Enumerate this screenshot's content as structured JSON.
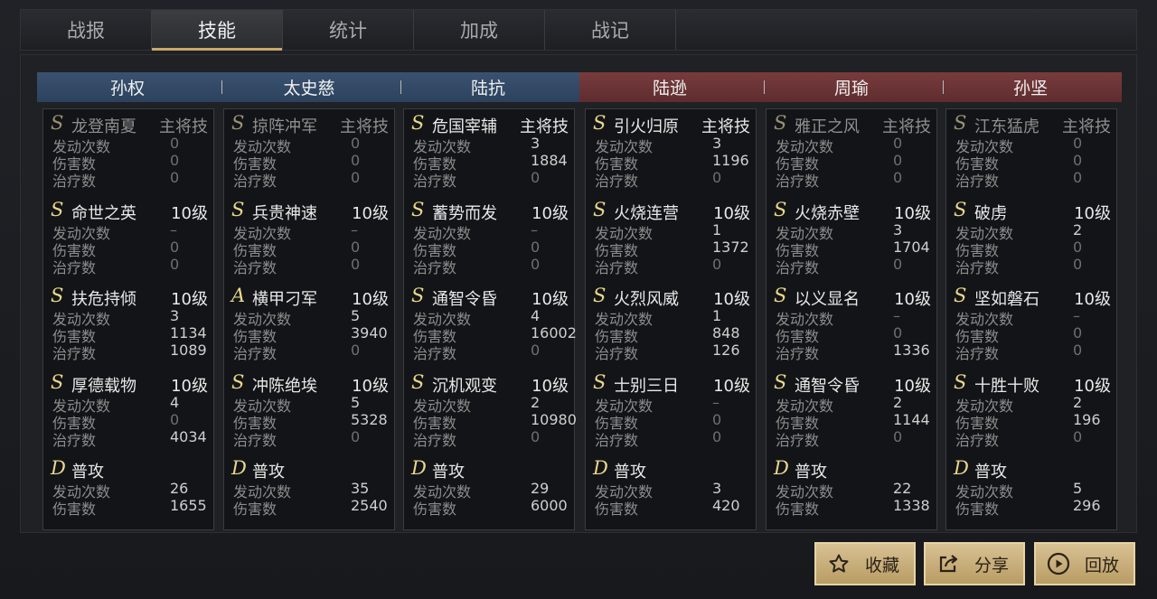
{
  "tabs": [
    "战报",
    "技能",
    "统计",
    "加成",
    "战记"
  ],
  "active_tab": 1,
  "generals": [
    {
      "name": "孙权",
      "skills": [
        {
          "grade": "S",
          "name": "龙登南夏",
          "level": "主将技",
          "dim": true,
          "stats": [
            [
              "发动次数",
              "0"
            ],
            [
              "伤害数",
              "0"
            ],
            [
              "治疗数",
              "0"
            ]
          ]
        },
        {
          "grade": "S",
          "name": "命世之英",
          "level": "10级",
          "stats": [
            [
              "发动次数",
              "–"
            ],
            [
              "伤害数",
              "0"
            ],
            [
              "治疗数",
              "0"
            ]
          ]
        },
        {
          "grade": "S",
          "name": "扶危持倾",
          "level": "10级",
          "stats": [
            [
              "发动次数",
              "3"
            ],
            [
              "伤害数",
              "1134"
            ],
            [
              "治疗数",
              "1089"
            ]
          ]
        },
        {
          "grade": "S",
          "name": "厚德载物",
          "level": "10级",
          "stats": [
            [
              "发动次数",
              "4"
            ],
            [
              "伤害数",
              "0"
            ],
            [
              "治疗数",
              "4034"
            ]
          ]
        },
        {
          "grade": "D",
          "name": "普攻",
          "level": "",
          "stats": [
            [
              "发动次数",
              "26"
            ],
            [
              "伤害数",
              "1655"
            ]
          ]
        }
      ]
    },
    {
      "name": "太史慈",
      "skills": [
        {
          "grade": "S",
          "name": "掠阵冲军",
          "level": "主将技",
          "dim": true,
          "stats": [
            [
              "发动次数",
              "0"
            ],
            [
              "伤害数",
              "0"
            ],
            [
              "治疗数",
              "0"
            ]
          ]
        },
        {
          "grade": "S",
          "name": "兵贵神速",
          "level": "10级",
          "stats": [
            [
              "发动次数",
              "–"
            ],
            [
              "伤害数",
              "0"
            ],
            [
              "治疗数",
              "0"
            ]
          ]
        },
        {
          "grade": "A",
          "name": "横甲刁军",
          "level": "10级",
          "stats": [
            [
              "发动次数",
              "5"
            ],
            [
              "伤害数",
              "3940"
            ],
            [
              "治疗数",
              "0"
            ]
          ]
        },
        {
          "grade": "S",
          "name": "冲陈绝埃",
          "level": "10级",
          "stats": [
            [
              "发动次数",
              "5"
            ],
            [
              "伤害数",
              "5328"
            ],
            [
              "治疗数",
              "0"
            ]
          ]
        },
        {
          "grade": "D",
          "name": "普攻",
          "level": "",
          "stats": [
            [
              "发动次数",
              "35"
            ],
            [
              "伤害数",
              "2540"
            ]
          ]
        }
      ]
    },
    {
      "name": "陆抗",
      "skills": [
        {
          "grade": "S",
          "name": "危国宰辅",
          "level": "主将技",
          "stats": [
            [
              "发动次数",
              "3"
            ],
            [
              "伤害数",
              "1884"
            ],
            [
              "治疗数",
              "0"
            ]
          ]
        },
        {
          "grade": "S",
          "name": "蓄势而发",
          "level": "10级",
          "stats": [
            [
              "发动次数",
              "–"
            ],
            [
              "伤害数",
              "0"
            ],
            [
              "治疗数",
              "0"
            ]
          ]
        },
        {
          "grade": "S",
          "name": "通智令昏",
          "level": "10级",
          "stats": [
            [
              "发动次数",
              "4"
            ],
            [
              "伤害数",
              "16002"
            ],
            [
              "治疗数",
              "0"
            ]
          ]
        },
        {
          "grade": "S",
          "name": "沉机观变",
          "level": "10级",
          "stats": [
            [
              "发动次数",
              "2"
            ],
            [
              "伤害数",
              "10980"
            ],
            [
              "治疗数",
              "0"
            ]
          ]
        },
        {
          "grade": "D",
          "name": "普攻",
          "level": "",
          "stats": [
            [
              "发动次数",
              "29"
            ],
            [
              "伤害数",
              "6000"
            ]
          ]
        }
      ]
    },
    {
      "name": "陆逊",
      "skills": [
        {
          "grade": "S",
          "name": "引火归原",
          "level": "主将技",
          "stats": [
            [
              "发动次数",
              "3"
            ],
            [
              "伤害数",
              "1196"
            ],
            [
              "治疗数",
              "0"
            ]
          ]
        },
        {
          "grade": "S",
          "name": "火烧连营",
          "level": "10级",
          "stats": [
            [
              "发动次数",
              "1"
            ],
            [
              "伤害数",
              "1372"
            ],
            [
              "治疗数",
              "0"
            ]
          ]
        },
        {
          "grade": "S",
          "name": "火烈风威",
          "level": "10级",
          "stats": [
            [
              "发动次数",
              "1"
            ],
            [
              "伤害数",
              "848"
            ],
            [
              "治疗数",
              "126"
            ]
          ]
        },
        {
          "grade": "S",
          "name": "士别三日",
          "level": "10级",
          "stats": [
            [
              "发动次数",
              "–"
            ],
            [
              "伤害数",
              "0"
            ],
            [
              "治疗数",
              "0"
            ]
          ]
        },
        {
          "grade": "D",
          "name": "普攻",
          "level": "",
          "stats": [
            [
              "发动次数",
              "3"
            ],
            [
              "伤害数",
              "420"
            ]
          ]
        }
      ]
    },
    {
      "name": "周瑜",
      "skills": [
        {
          "grade": "S",
          "name": "雅正之风",
          "level": "主将技",
          "dim": true,
          "stats": [
            [
              "发动次数",
              "0"
            ],
            [
              "伤害数",
              "0"
            ],
            [
              "治疗数",
              "0"
            ]
          ]
        },
        {
          "grade": "S",
          "name": "火烧赤壁",
          "level": "10级",
          "stats": [
            [
              "发动次数",
              "3"
            ],
            [
              "伤害数",
              "1704"
            ],
            [
              "治疗数",
              "0"
            ]
          ]
        },
        {
          "grade": "S",
          "name": "以义显名",
          "level": "10级",
          "stats": [
            [
              "发动次数",
              "–"
            ],
            [
              "伤害数",
              "0"
            ],
            [
              "治疗数",
              "1336"
            ]
          ]
        },
        {
          "grade": "S",
          "name": "通智令昏",
          "level": "10级",
          "stats": [
            [
              "发动次数",
              "2"
            ],
            [
              "伤害数",
              "1144"
            ],
            [
              "治疗数",
              "0"
            ]
          ]
        },
        {
          "grade": "D",
          "name": "普攻",
          "level": "",
          "stats": [
            [
              "发动次数",
              "22"
            ],
            [
              "伤害数",
              "1338"
            ]
          ]
        }
      ]
    },
    {
      "name": "孙坚",
      "skills": [
        {
          "grade": "S",
          "name": "江东猛虎",
          "level": "主将技",
          "dim": true,
          "stats": [
            [
              "发动次数",
              "0"
            ],
            [
              "伤害数",
              "0"
            ],
            [
              "治疗数",
              "0"
            ]
          ]
        },
        {
          "grade": "S",
          "name": "破虏",
          "level": "10级",
          "stats": [
            [
              "发动次数",
              "2"
            ],
            [
              "伤害数",
              "0"
            ],
            [
              "治疗数",
              "0"
            ]
          ]
        },
        {
          "grade": "S",
          "name": "坚如磐石",
          "level": "10级",
          "stats": [
            [
              "发动次数",
              "–"
            ],
            [
              "伤害数",
              "0"
            ],
            [
              "治疗数",
              "0"
            ]
          ]
        },
        {
          "grade": "S",
          "name": "十胜十败",
          "level": "10级",
          "stats": [
            [
              "发动次数",
              "2"
            ],
            [
              "伤害数",
              "196"
            ],
            [
              "治疗数",
              "0"
            ]
          ]
        },
        {
          "grade": "D",
          "name": "普攻",
          "level": "",
          "stats": [
            [
              "发动次数",
              "5"
            ],
            [
              "伤害数",
              "296"
            ]
          ]
        }
      ]
    }
  ],
  "buttons": {
    "favorite": "收藏",
    "share": "分享",
    "replay": "回放"
  },
  "icons": {
    "favorite": "star-outline-icon",
    "share": "share-arrow-icon",
    "replay": "play-circle-icon"
  },
  "colors": {
    "left_team": "#34506e",
    "right_team": "#6c3537",
    "gold": "#c9a868",
    "skill_grade": "#e8d78c"
  }
}
